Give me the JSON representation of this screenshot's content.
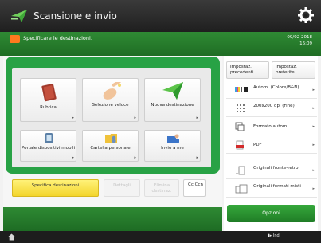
{
  "title_bar": {
    "title": "Scansione e invio",
    "settings_icon": "gear-icon"
  },
  "status_bar": {
    "message": "Specificare le destinazioni.",
    "date": "09/02 2018",
    "time": "16:09"
  },
  "function_buttons": [
    {
      "label": "Rubrica",
      "icon": "address-book-icon"
    },
    {
      "label": "Selezione veloce",
      "icon": "hand-pointer-icon"
    },
    {
      "label": "Nuova destinazione",
      "icon": "paper-plane-icon"
    },
    {
      "label": "Portale dispositivi mobili",
      "icon": "mobile-portal-icon"
    },
    {
      "label": "Cartella personale",
      "icon": "personal-folder-icon"
    },
    {
      "label": "Invio a me",
      "icon": "send-to-me-icon"
    }
  ],
  "bottom_buttons": {
    "specify": "Specifica destinazioni",
    "details": "Dettagli",
    "delete": "Elimina destinaz.",
    "cc_bcc": "Cc Ccn"
  },
  "right_panel": {
    "previous_settings": "Impostaz. precedenti",
    "favorite_settings": "Impostaz. preferite",
    "color": "Autom. (Colore/B&N)",
    "resolution": "200x200 dpi (Fine)",
    "format": "Formato autom.",
    "file_type": "PDF",
    "duplex": "Originali fronte-retro",
    "mixed_sizes": "Originali formati misti",
    "options": "Opzioni"
  },
  "bottom_bar": {
    "status_monitor": "Ind."
  },
  "colors": {
    "accent_green": "#28a245",
    "yellow_button": "#f3d52c",
    "title_bg": "#2a2a2a"
  }
}
